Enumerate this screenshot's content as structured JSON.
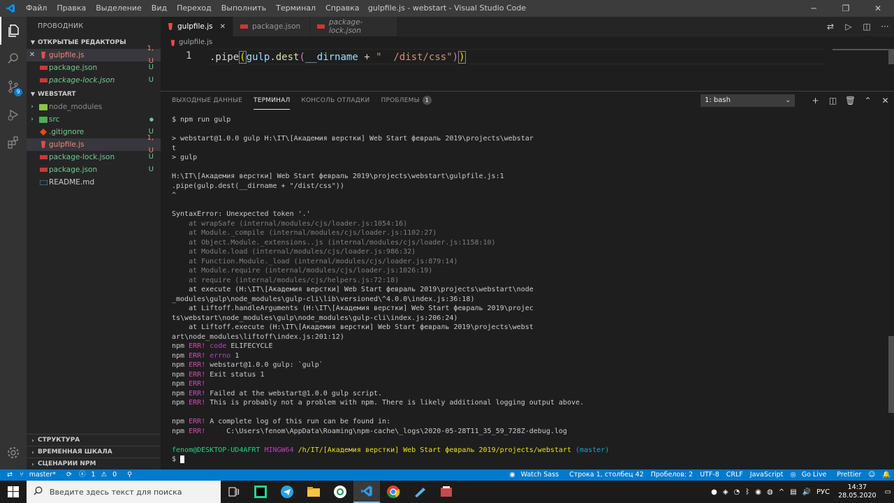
{
  "window": {
    "title": "gulpfile.js - webstart - Visual Studio Code",
    "menu": [
      "Файл",
      "Правка",
      "Выделение",
      "Вид",
      "Переход",
      "Выполнить",
      "Терминал",
      "Справка"
    ]
  },
  "activity_badge": "9",
  "sidebar": {
    "title": "ПРОВОДНИК",
    "open_editors_title": "ОТКРЫТЫЕ РЕДАКТОРЫ",
    "open_editors": [
      {
        "name": "gulpfile.js",
        "status": "1, U"
      },
      {
        "name": "package.json",
        "status": "U"
      },
      {
        "name": "package-lock.json",
        "status": "U"
      }
    ],
    "project_title": "WEBSTART",
    "tree": [
      {
        "name": "node_modules",
        "status": ""
      },
      {
        "name": "src",
        "status": "●"
      },
      {
        "name": ".gitignore",
        "status": "U"
      },
      {
        "name": "gulpfile.js",
        "status": "1, U"
      },
      {
        "name": "package-lock.json",
        "status": "U"
      },
      {
        "name": "package.json",
        "status": "U"
      },
      {
        "name": "README.md",
        "status": ""
      }
    ],
    "bottom_sections": [
      "СТРУКТУРА",
      "ВРЕМЕННАЯ ШКАЛА",
      "СЦЕНАРИИ NPM"
    ]
  },
  "tabs": [
    {
      "label": "gulpfile.js"
    },
    {
      "label": "package.json"
    },
    {
      "label": "package-lock.json"
    }
  ],
  "breadcrumb": "gulpfile.js",
  "editor": {
    "line_number": "1",
    "code_parts": [
      ".pipe",
      "(",
      "gulp",
      ".",
      "dest",
      "(",
      "__dirname",
      " + ",
      "\"  /dist/css\"",
      ")",
      ")"
    ]
  },
  "panel": {
    "tabs": [
      "ВЫХОДНЫЕ ДАННЫЕ",
      "ТЕРМИНАЛ",
      "КОНСОЛЬ ОТЛАДКИ",
      "ПРОБЛЕМЫ"
    ],
    "problems_count": "1",
    "terminal_select": "1: bash"
  },
  "terminal": {
    "lines": [
      {
        "t": "$ npm run gulp",
        "c": ""
      },
      {
        "t": "",
        "c": ""
      },
      {
        "t": "> webstart@1.0.0 gulp H:\\IT\\[Академия верстки] Web Start февраль 2019\\projects\\webstar",
        "c": ""
      },
      {
        "t": "t",
        "c": ""
      },
      {
        "t": "> gulp",
        "c": ""
      },
      {
        "t": "",
        "c": ""
      },
      {
        "t": "H:\\IT\\[Академия верстки] Web Start февраль 2019\\projects\\webstart\\gulpfile.js:1",
        "c": ""
      },
      {
        "t": ".pipe(gulp.dest(__dirname + \"/dist/css\"))",
        "c": ""
      },
      {
        "t": "^",
        "c": ""
      },
      {
        "t": "",
        "c": ""
      },
      {
        "t": "SyntaxError: Unexpected token '.'",
        "c": ""
      },
      {
        "t": "    at wrapSafe (internal/modules/cjs/loader.js:1054:16)",
        "c": "dim"
      },
      {
        "t": "    at Module._compile (internal/modules/cjs/loader.js:1102:27)",
        "c": "dim"
      },
      {
        "t": "    at Object.Module._extensions..js (internal/modules/cjs/loader.js:1158:10)",
        "c": "dim"
      },
      {
        "t": "    at Module.load (internal/modules/cjs/loader.js:986:32)",
        "c": "dim"
      },
      {
        "t": "    at Function.Module._load (internal/modules/cjs/loader.js:879:14)",
        "c": "dim"
      },
      {
        "t": "    at Module.require (internal/modules/cjs/loader.js:1026:19)",
        "c": "dim"
      },
      {
        "t": "    at require (internal/modules/cjs/helpers.js:72:18)",
        "c": "dim"
      },
      {
        "t": "    at execute (H:\\IT\\[Академия верстки] Web Start февраль 2019\\projects\\webstart\\node",
        "c": ""
      },
      {
        "t": "_modules\\gulp\\node_modules\\gulp-cli\\lib\\versioned\\^4.0.0\\index.js:36:18)",
        "c": ""
      },
      {
        "t": "    at Liftoff.handleArguments (H:\\IT\\[Академия верстки] Web Start февраль 2019\\projec",
        "c": ""
      },
      {
        "t": "ts\\webstart\\node_modules\\gulp\\node_modules\\gulp-cli\\index.js:206:24)",
        "c": ""
      },
      {
        "t": "    at Liftoff.execute (H:\\IT\\[Академия верстки] Web Start февраль 2019\\projects\\webst",
        "c": ""
      },
      {
        "t": "art\\node_modules\\liftoff\\index.js:201:12)",
        "c": ""
      }
    ],
    "npm_lines": [
      {
        "label": "ERR!",
        "msg": "code",
        "rest": " ELIFECYCLE"
      },
      {
        "label": "ERR!",
        "msg": "errno",
        "rest": " 1"
      },
      {
        "label": "ERR!",
        "msg": "",
        "rest": "webstart@1.0.0 gulp: `gulp`"
      },
      {
        "label": "ERR!",
        "msg": "",
        "rest": "Exit status 1"
      },
      {
        "label": "ERR!",
        "msg": "",
        "rest": ""
      },
      {
        "label": "ERR!",
        "msg": "",
        "rest": "Failed at the webstart@1.0.0 gulp script."
      },
      {
        "label": "ERR!",
        "msg": "",
        "rest": "This is probably not a problem with npm. There is likely additional logging output above."
      }
    ],
    "npm_lines2": [
      {
        "label": "ERR!",
        "rest": "A complete log of this run can be found in:"
      },
      {
        "label": "ERR!",
        "rest": "    C:\\Users\\fenom\\AppData\\Roaming\\npm-cache\\_logs\\2020-05-28T11_35_59_728Z-debug.log"
      }
    ],
    "npm_prefix": "npm",
    "prompt_user": "fenom@DESKTOP-UD4AFRT",
    "prompt_shell": "MINGW64",
    "prompt_path": "/h/IT/[Академия верстки] Web Start февраль 2019/projects/webstart",
    "prompt_branch": "(master)",
    "prompt_symbol": "$"
  },
  "statusbar": {
    "branch": "master*",
    "errors": "1",
    "warnings": "0",
    "watch_sass": "Watch Sass",
    "position": "Строка 1, столбец 42",
    "spaces": "Пробелов: 2",
    "encoding": "UTF-8",
    "eol": "CRLF",
    "language": "JavaScript",
    "go_live": "Go Live",
    "prettier": "Prettier"
  },
  "taskbar": {
    "search_placeholder": "Введите здесь текст для поиска",
    "lang": "РУС",
    "time": "14:37",
    "date": "28.05.2020"
  }
}
